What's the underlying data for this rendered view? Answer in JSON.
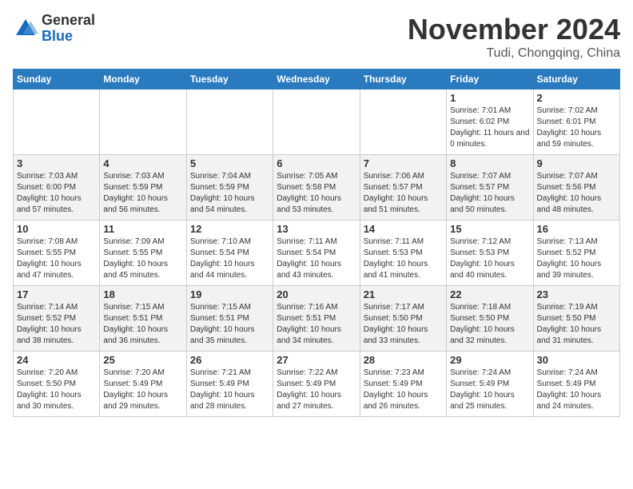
{
  "header": {
    "logo_general": "General",
    "logo_blue": "Blue",
    "month": "November 2024",
    "location": "Tudi, Chongqing, China"
  },
  "weekdays": [
    "Sunday",
    "Monday",
    "Tuesday",
    "Wednesday",
    "Thursday",
    "Friday",
    "Saturday"
  ],
  "weeks": [
    [
      {
        "day": "",
        "info": ""
      },
      {
        "day": "",
        "info": ""
      },
      {
        "day": "",
        "info": ""
      },
      {
        "day": "",
        "info": ""
      },
      {
        "day": "",
        "info": ""
      },
      {
        "day": "1",
        "info": "Sunrise: 7:01 AM\nSunset: 6:02 PM\nDaylight: 11 hours and 0 minutes."
      },
      {
        "day": "2",
        "info": "Sunrise: 7:02 AM\nSunset: 6:01 PM\nDaylight: 10 hours and 59 minutes."
      }
    ],
    [
      {
        "day": "3",
        "info": "Sunrise: 7:03 AM\nSunset: 6:00 PM\nDaylight: 10 hours and 57 minutes."
      },
      {
        "day": "4",
        "info": "Sunrise: 7:03 AM\nSunset: 5:59 PM\nDaylight: 10 hours and 56 minutes."
      },
      {
        "day": "5",
        "info": "Sunrise: 7:04 AM\nSunset: 5:59 PM\nDaylight: 10 hours and 54 minutes."
      },
      {
        "day": "6",
        "info": "Sunrise: 7:05 AM\nSunset: 5:58 PM\nDaylight: 10 hours and 53 minutes."
      },
      {
        "day": "7",
        "info": "Sunrise: 7:06 AM\nSunset: 5:57 PM\nDaylight: 10 hours and 51 minutes."
      },
      {
        "day": "8",
        "info": "Sunrise: 7:07 AM\nSunset: 5:57 PM\nDaylight: 10 hours and 50 minutes."
      },
      {
        "day": "9",
        "info": "Sunrise: 7:07 AM\nSunset: 5:56 PM\nDaylight: 10 hours and 48 minutes."
      }
    ],
    [
      {
        "day": "10",
        "info": "Sunrise: 7:08 AM\nSunset: 5:55 PM\nDaylight: 10 hours and 47 minutes."
      },
      {
        "day": "11",
        "info": "Sunrise: 7:09 AM\nSunset: 5:55 PM\nDaylight: 10 hours and 45 minutes."
      },
      {
        "day": "12",
        "info": "Sunrise: 7:10 AM\nSunset: 5:54 PM\nDaylight: 10 hours and 44 minutes."
      },
      {
        "day": "13",
        "info": "Sunrise: 7:11 AM\nSunset: 5:54 PM\nDaylight: 10 hours and 43 minutes."
      },
      {
        "day": "14",
        "info": "Sunrise: 7:11 AM\nSunset: 5:53 PM\nDaylight: 10 hours and 41 minutes."
      },
      {
        "day": "15",
        "info": "Sunrise: 7:12 AM\nSunset: 5:53 PM\nDaylight: 10 hours and 40 minutes."
      },
      {
        "day": "16",
        "info": "Sunrise: 7:13 AM\nSunset: 5:52 PM\nDaylight: 10 hours and 39 minutes."
      }
    ],
    [
      {
        "day": "17",
        "info": "Sunrise: 7:14 AM\nSunset: 5:52 PM\nDaylight: 10 hours and 38 minutes."
      },
      {
        "day": "18",
        "info": "Sunrise: 7:15 AM\nSunset: 5:51 PM\nDaylight: 10 hours and 36 minutes."
      },
      {
        "day": "19",
        "info": "Sunrise: 7:15 AM\nSunset: 5:51 PM\nDaylight: 10 hours and 35 minutes."
      },
      {
        "day": "20",
        "info": "Sunrise: 7:16 AM\nSunset: 5:51 PM\nDaylight: 10 hours and 34 minutes."
      },
      {
        "day": "21",
        "info": "Sunrise: 7:17 AM\nSunset: 5:50 PM\nDaylight: 10 hours and 33 minutes."
      },
      {
        "day": "22",
        "info": "Sunrise: 7:18 AM\nSunset: 5:50 PM\nDaylight: 10 hours and 32 minutes."
      },
      {
        "day": "23",
        "info": "Sunrise: 7:19 AM\nSunset: 5:50 PM\nDaylight: 10 hours and 31 minutes."
      }
    ],
    [
      {
        "day": "24",
        "info": "Sunrise: 7:20 AM\nSunset: 5:50 PM\nDaylight: 10 hours and 30 minutes."
      },
      {
        "day": "25",
        "info": "Sunrise: 7:20 AM\nSunset: 5:49 PM\nDaylight: 10 hours and 29 minutes."
      },
      {
        "day": "26",
        "info": "Sunrise: 7:21 AM\nSunset: 5:49 PM\nDaylight: 10 hours and 28 minutes."
      },
      {
        "day": "27",
        "info": "Sunrise: 7:22 AM\nSunset: 5:49 PM\nDaylight: 10 hours and 27 minutes."
      },
      {
        "day": "28",
        "info": "Sunrise: 7:23 AM\nSunset: 5:49 PM\nDaylight: 10 hours and 26 minutes."
      },
      {
        "day": "29",
        "info": "Sunrise: 7:24 AM\nSunset: 5:49 PM\nDaylight: 10 hours and 25 minutes."
      },
      {
        "day": "30",
        "info": "Sunrise: 7:24 AM\nSunset: 5:49 PM\nDaylight: 10 hours and 24 minutes."
      }
    ]
  ]
}
